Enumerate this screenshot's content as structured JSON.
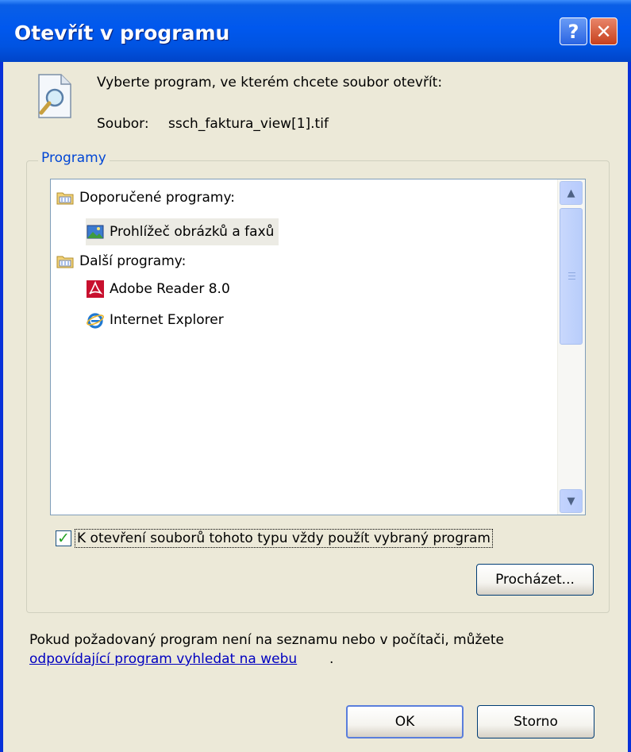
{
  "window": {
    "title": "Otevřít v programu"
  },
  "titlebar_buttons": {
    "help": "?",
    "close": "✕"
  },
  "header": {
    "prompt": "Vyberte program, ve kterém chcete soubor otevřít:",
    "file_label": "Soubor:",
    "file_name": "ssch_faktura_view[1].tif"
  },
  "programs": {
    "group_label": "Programy",
    "recommended_header": "Doporučené programy:",
    "recommended": [
      {
        "label": "Prohlížeč obrázků a faxů",
        "icon": "image-viewer-icon"
      }
    ],
    "other_header": "Další programy:",
    "other": [
      {
        "label": "Adobe Reader 8.0",
        "icon": "adobe-reader-icon"
      },
      {
        "label": "Internet Explorer",
        "icon": "internet-explorer-icon"
      }
    ],
    "always_use_label": "K otevření souborů tohoto typu vždy použít vybraný program",
    "always_use_checked": true,
    "browse_label": "Procházet..."
  },
  "footer": {
    "text": "Pokud požadovaný program není na seznamu nebo v počítači, můžete",
    "link": "odpovídající program vyhledat na webu",
    "link_suffix": "."
  },
  "buttons": {
    "ok": "OK",
    "cancel": "Storno"
  },
  "colors": {
    "titlebar": "#0058ee",
    "link": "#0000c0",
    "accent": "#0046d5",
    "dialog_bg": "#ece9d8"
  }
}
